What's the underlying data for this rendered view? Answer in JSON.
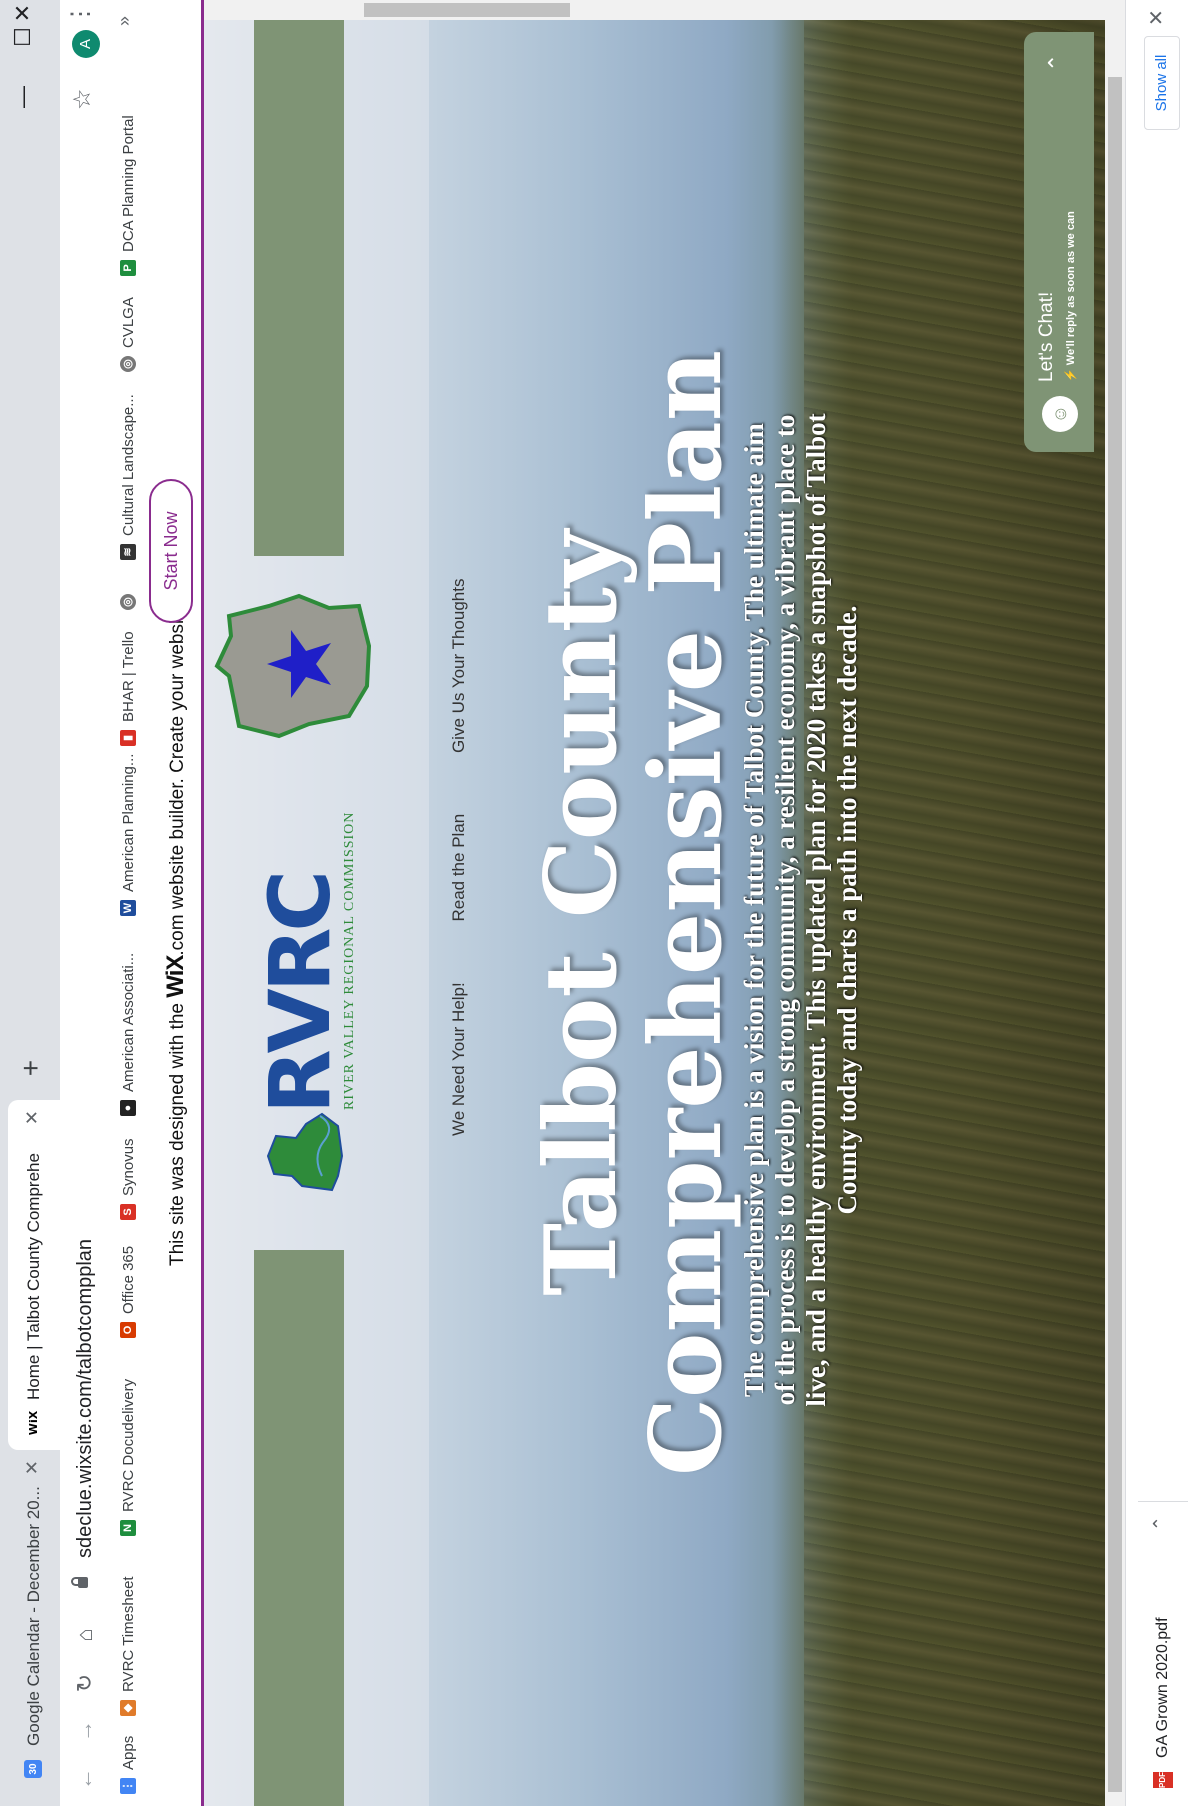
{
  "browser": {
    "tabs": [
      {
        "label": "Google Calendar - December 20...",
        "favicon": "calendar-favicon",
        "favicon_text": "30"
      },
      {
        "label": "Home | Talbot County Comprehe",
        "favicon": "wix-favicon",
        "favicon_text": "WiX"
      }
    ],
    "url": "sdeclue.wixsite.com/talbotcompplan",
    "avatar_letter": "A",
    "bookmarks": [
      {
        "label": "Apps",
        "icon": "apps-grid-icon"
      },
      {
        "label": "RVRC Timesheet",
        "icon": "timesheet-icon"
      },
      {
        "label": "RVRC Docudelivery",
        "icon": "docudelivery-icon"
      },
      {
        "label": "Office 365",
        "icon": "office-icon"
      },
      {
        "label": "Synovus",
        "icon": "synovus-icon"
      },
      {
        "label": "American Associati...",
        "icon": "association-icon"
      },
      {
        "label": "American Planning...",
        "icon": "planning-icon"
      },
      {
        "label": "BHAR | Trello",
        "icon": "trello-icon"
      },
      {
        "label": "",
        "icon": "globe-icon"
      },
      {
        "label": "Cultural Landscape...",
        "icon": "landscape-icon"
      },
      {
        "label": "CVLGA",
        "icon": "globe-icon"
      },
      {
        "label": "DCA Planning Portal",
        "icon": "dca-icon"
      }
    ]
  },
  "wix_banner": {
    "text_before": "This site was designed with the ",
    "brand": "WiX",
    "text_after": ".com website builder. Create your website today.",
    "button": "Start Now"
  },
  "site": {
    "logo_word": "RVRC",
    "logo_sub": "RIVER VALLEY REGIONAL COMMISSION",
    "nav": [
      "We Need Your Help!",
      "Read the Plan",
      "Give Us Your Thoughts"
    ],
    "title_line1": "Talbot County",
    "title_line2": "Comprehensive Plan",
    "intro": "The comprehensive plan is a vision for the future of Talbot County. The ultimate aim of the process is to develop a strong community, a resilient economy, a vibrant place to live, and a healthy environment. This updated plan for 2020 takes a snapshot of Talbot County today and charts a path into the next decade."
  },
  "chat": {
    "title": "Let's Chat!",
    "subtitle": "We'll reply as soon as we can"
  },
  "downloads": {
    "file": "GA Grown 2020.pdf",
    "show_all": "Show all"
  },
  "colors": {
    "accent_green": "#7f9475",
    "wix_purple": "#8a2c8e",
    "logo_blue": "#1f4d9c",
    "logo_green": "#2e8b3a"
  }
}
